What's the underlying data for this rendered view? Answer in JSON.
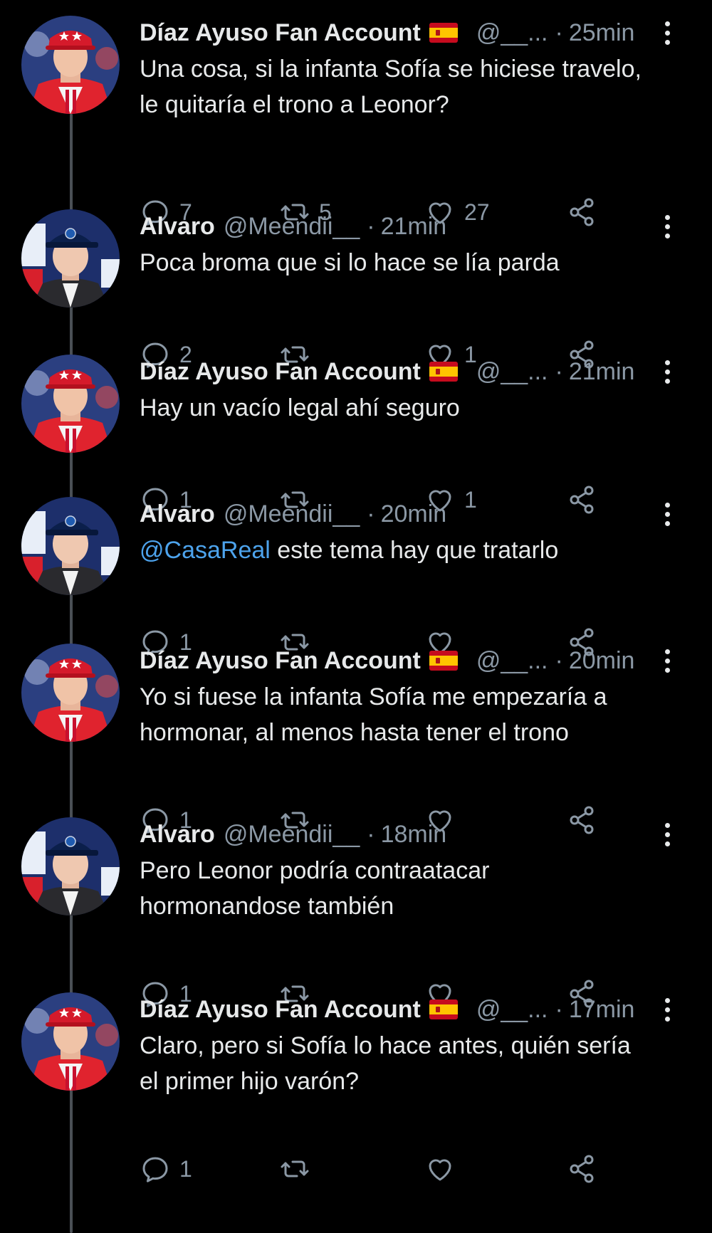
{
  "users": {
    "ayuso": {
      "name": "Díaz Ayuso Fan Account",
      "handle": "@__..."
    },
    "alvaro": {
      "name": "Alvaro",
      "handle": "@Meendii__"
    }
  },
  "tweets": [
    {
      "user": "ayuso",
      "name": "Díaz Ayuso Fan Account",
      "handle": "@__...",
      "time": "25min",
      "lines": [
        "Una cosa, si la infanta Sofía se hiciese travelo,",
        "le quitaría el trono a Leonor?"
      ],
      "replies": "7",
      "retweets": "5",
      "likes": "27"
    },
    {
      "user": "alvaro",
      "name": "Alvaro",
      "handle": "@Meendii__",
      "time": "21min",
      "lines": [
        "Poca broma que si lo hace se lía parda"
      ],
      "replies": "2",
      "retweets": "",
      "likes": "1"
    },
    {
      "user": "ayuso",
      "name": "Díaz Ayuso Fan Account",
      "handle": "@__...",
      "time": "21min",
      "lines": [
        "Hay un vacío legal ahí seguro"
      ],
      "replies": "1",
      "retweets": "",
      "likes": "1"
    },
    {
      "user": "alvaro",
      "name": "Alvaro",
      "handle": "@Meendii__",
      "time": "20min",
      "mention": "@CasaReal",
      "lines": [
        " este tema hay que tratarlo"
      ],
      "replies": "1",
      "retweets": "",
      "likes": ""
    },
    {
      "user": "ayuso",
      "name": "Díaz Ayuso Fan Account",
      "handle": "@__...",
      "time": "20min",
      "lines": [
        "Yo si fuese la infanta Sofía me empezaría a",
        "hormonar, al menos hasta tener el trono"
      ],
      "replies": "1",
      "retweets": "",
      "likes": ""
    },
    {
      "user": "alvaro",
      "name": "Alvaro",
      "handle": "@Meendii__",
      "time": "18min",
      "lines": [
        "Pero Leonor podría contraatacar",
        "hormonandose también"
      ],
      "replies": "1",
      "retweets": "",
      "likes": ""
    },
    {
      "user": "ayuso",
      "name": "Díaz Ayuso Fan Account",
      "handle": "@__...",
      "time": "17min",
      "lines": [
        "Claro, pero si Sofía lo hace antes, quién sería",
        "el primer hijo varón?"
      ],
      "replies": "1",
      "retweets": "",
      "likes": ""
    }
  ],
  "icons": {
    "reply": "reply-icon",
    "retweet": "retweet-icon",
    "like": "heart-icon",
    "share": "share-icon",
    "more": "more-vertical-icon",
    "flag": "spain-flag-icon"
  },
  "colors": {
    "background": "#000000",
    "text": "#e7e9ea",
    "muted": "#8b98a5",
    "link": "#4da3ec",
    "thread_line": "#4a4f55"
  }
}
